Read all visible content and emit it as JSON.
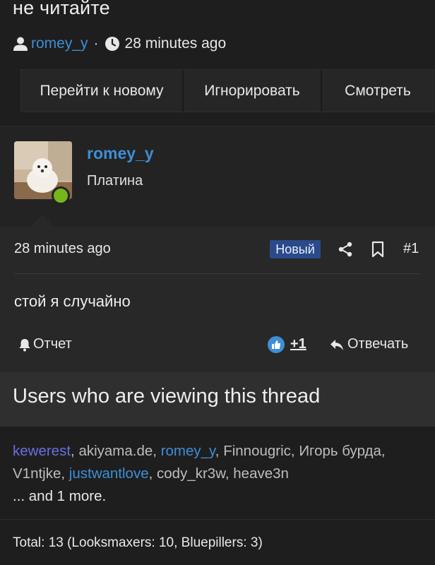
{
  "thread": {
    "title": "не читайте",
    "author": "romey_y",
    "separator": "·",
    "time": "28 minutes ago"
  },
  "actions": {
    "goto_new": "Перейти к новому",
    "ignore": "Игнорировать",
    "watch": "Смотреть"
  },
  "post": {
    "username": "romey_y",
    "rank": "Платина",
    "time": "28 minutes ago",
    "badge": "Новый",
    "number": "#1",
    "text": "стой я случайно",
    "report_label": "Отчет",
    "reaction_count": "+1",
    "reply_label": "Отвечать",
    "online_color": "#76b51b"
  },
  "viewers": {
    "title": "Users who are viewing this thread",
    "users": [
      {
        "name": "kewerest",
        "color": "purple"
      },
      {
        "name": "akiyama.de",
        "color": "gray"
      },
      {
        "name": "romey_y",
        "color": "blue"
      },
      {
        "name": "Finnougric",
        "color": "gray"
      },
      {
        "name": "Игорь бурда",
        "color": "gray"
      },
      {
        "name": "V1ntjke",
        "color": "gray"
      },
      {
        "name": "justwantlove",
        "color": "blue"
      },
      {
        "name": "cody_kr3w",
        "color": "gray"
      },
      {
        "name": "heave3n",
        "color": "gray"
      }
    ],
    "more": "... and 1 more.",
    "total": "Total: 13 (Looksmaxers: 10, Bluepillers: 3)"
  },
  "colors": {
    "link_blue": "#3d8fd6",
    "link_purple": "#6b6ee0",
    "badge_bg": "#2a4a8a",
    "background": "#1e1e1f"
  },
  "icons": [
    "user-icon",
    "clock-icon",
    "share-icon",
    "bookmark-icon",
    "bell-icon",
    "like-icon",
    "reply-icon"
  ]
}
